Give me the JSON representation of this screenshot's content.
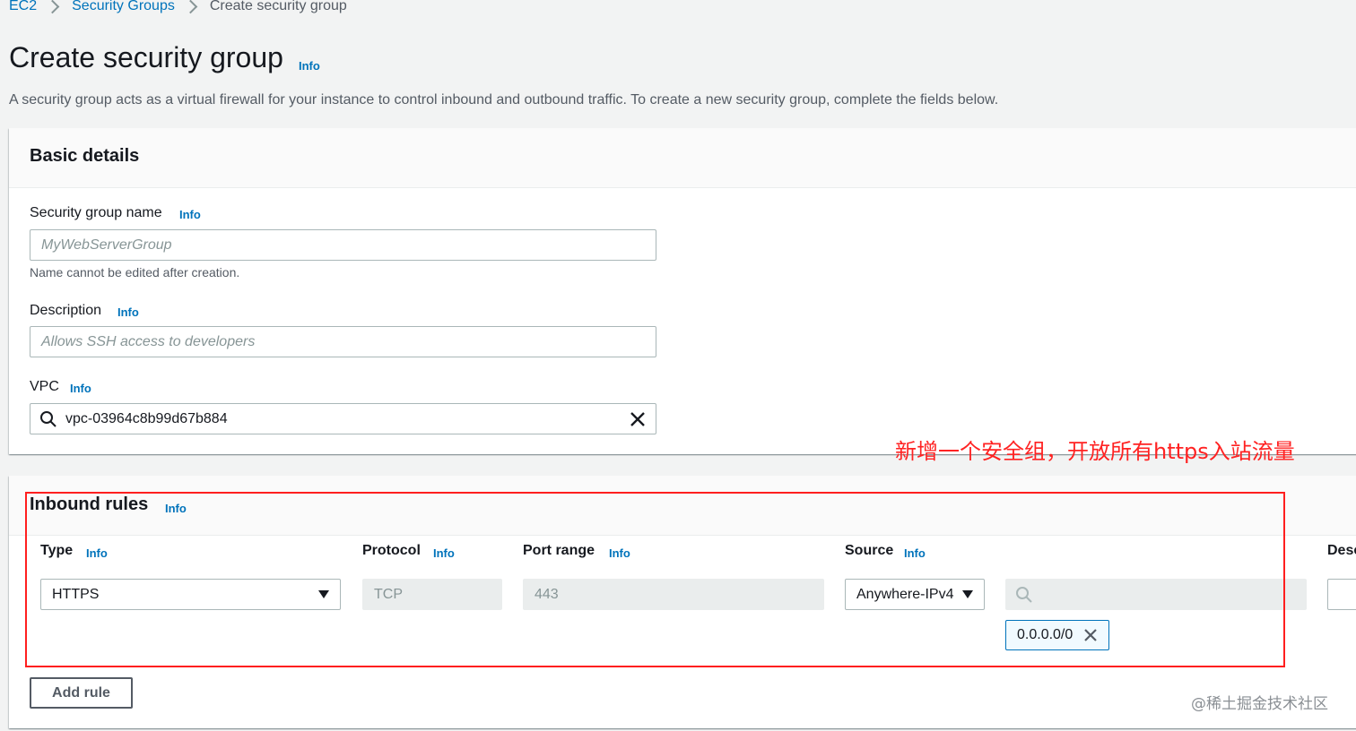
{
  "breadcrumb": [
    "EC2",
    "Security Groups",
    "Create security group"
  ],
  "page": {
    "title": "Create security group",
    "info": "Info",
    "description": "A security group acts as a virtual firewall for your instance to control inbound and outbound traffic. To create a new security group, complete the fields below."
  },
  "basic_details": {
    "heading": "Basic details",
    "name_label": "Security group name",
    "name_info": "Info",
    "name_placeholder": "MyWebServerGroup",
    "name_hint": "Name cannot be edited after creation.",
    "desc_label": "Description",
    "desc_info": "Info",
    "desc_placeholder": "Allows SSH access to developers",
    "vpc_label": "VPC",
    "vpc_info": "Info",
    "vpc_value": "vpc-03964c8b99d67b884"
  },
  "inbound": {
    "heading": "Inbound rules",
    "info": "Info",
    "columns": {
      "type": "Type",
      "protocol": "Protocol",
      "port_range": "Port range",
      "source": "Source",
      "description": "Desc"
    },
    "rule": {
      "type": "HTTPS",
      "protocol": "TCP",
      "port_range": "443",
      "source": "Anywhere-IPv4",
      "cidr": "0.0.0.0/0"
    },
    "add_rule": "Add rule"
  },
  "annotation": "新增一个安全组，开放所有https入站流量",
  "watermark": "@稀土掘金技术社区",
  "colors": {
    "link": "#0073bb",
    "annotation": "#ff2222",
    "background": "#f2f3f3"
  }
}
